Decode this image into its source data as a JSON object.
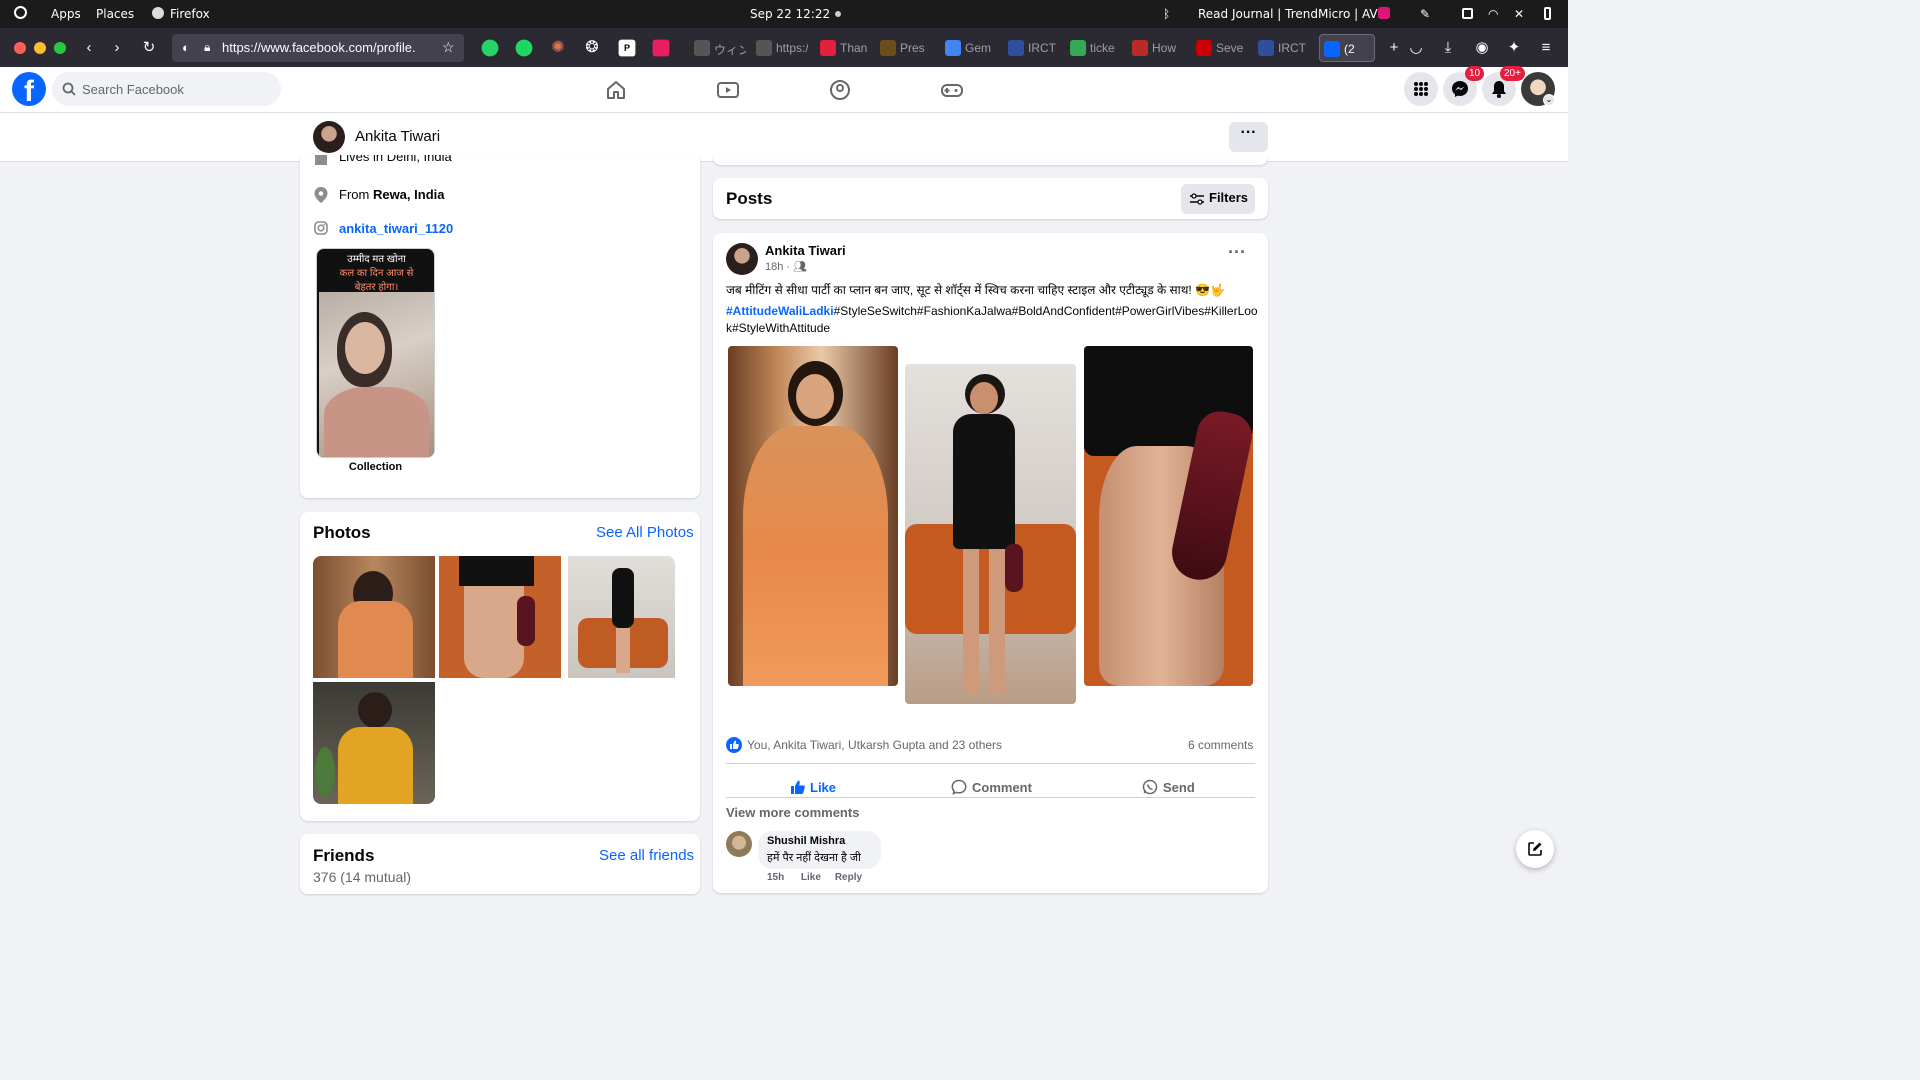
{
  "gnome": {
    "apps": "Apps",
    "places": "Places",
    "firefox": "Firefox",
    "datetime": "Sep 22  12:22",
    "window_title": "Read Journal | TrendMicro | AV"
  },
  "browser": {
    "url": "https://www.facebook.com/profile.",
    "tabs": [
      {
        "label": "ウィン",
        "color": "#555"
      },
      {
        "label": "https://s",
        "color": "#555"
      },
      {
        "label": "Than",
        "color": "#e41e3f"
      },
      {
        "label": "Pres",
        "color": "#6b4e1b"
      },
      {
        "label": "Gem",
        "color": "#4285f4"
      },
      {
        "label": "IRCT",
        "color": "#2d4f9e"
      },
      {
        "label": "ticke",
        "color": "#34a853"
      },
      {
        "label": "How",
        "color": "#b92b27"
      },
      {
        "label": "Seve",
        "color": "#cc0000"
      },
      {
        "label": "IRCT",
        "color": "#2d4f9e"
      },
      {
        "label": "(2",
        "color": "#0866ff"
      }
    ]
  },
  "fb": {
    "logo": "f",
    "search_placeholder": "Search Facebook",
    "messenger_badge": "10",
    "notif_badge": "20+"
  },
  "profile": {
    "name": "Ankita Tiwari",
    "more": "···"
  },
  "intro": {
    "lives_cut": "Lives in Delhi, India",
    "from_prefix": "From ",
    "from_place": "Rewa, India",
    "instagram": "ankita_tiwari_1120",
    "collection_quote_l1": "उम्मीद मत खोना",
    "collection_quote_l2": "कल का दिन आज से",
    "collection_quote_l3": "बेहतर होगा।",
    "collection_label": "Collection"
  },
  "photos": {
    "title": "Photos",
    "see_all": "See All Photos"
  },
  "friends": {
    "title": "Friends",
    "see_all": "See all friends",
    "count": "376 (14 mutual)"
  },
  "posts": {
    "title": "Posts",
    "filters": "Filters"
  },
  "post": {
    "author": "Ankita Tiwari",
    "time": "18h · ",
    "text": "जब मीटिंग से सीधा पार्टी का प्लान बन जाए, सूट से शॉर्ट्स में स्विच करना चाहिए स्टाइल और एटीट्यूड के साथ! 😎🤟",
    "hashtag_link": "#AttitudeWaliLadki",
    "hashtags_rest": "#StyleSeSwitch#FashionKaJalwa#BoldAndConfident#PowerGirlVibes#KillerLook#StyleWithAttitude",
    "reactions": "You, Ankita Tiwari, Utkarsh Gupta and 23 others",
    "comments_count": "6 comments",
    "like": "Like",
    "comment": "Comment",
    "send": "Send",
    "view_more": "View more comments",
    "commenter": "Shushil Mishra",
    "comment_text": "हमें पैर नहीं देखना है जी",
    "comment_time": "15h",
    "comment_like": "Like",
    "comment_reply": "Reply"
  }
}
